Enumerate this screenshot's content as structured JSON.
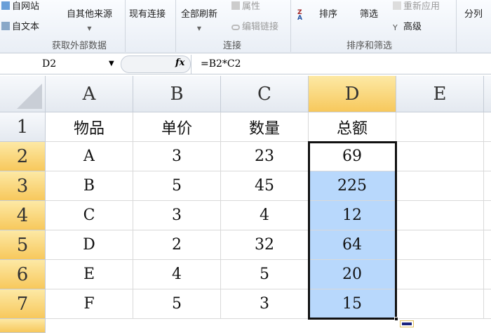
{
  "ribbon": {
    "from_web": "自网站",
    "from_text": "自文本",
    "from_other": "自其他来源",
    "existing": "现有连接",
    "refresh_all": "全部刷新",
    "properties": "属性",
    "edit_links": "编辑链接",
    "sort": "排序",
    "filter": "筛选",
    "reapply": "重新应用",
    "advanced": "高级",
    "split": "分列",
    "groups": [
      "获取外部数据",
      "连接",
      "排序和筛选"
    ]
  },
  "formula_bar": {
    "name_box": "D2",
    "fx": "fx",
    "formula": "=B2*C2"
  },
  "columns": [
    "A",
    "B",
    "C",
    "D",
    "E"
  ],
  "rows": [
    "1",
    "2",
    "3",
    "4",
    "5",
    "6",
    "7"
  ],
  "table": [
    [
      "物品",
      "单价",
      "数量",
      "总额"
    ],
    [
      "A",
      "3",
      "23",
      "69"
    ],
    [
      "B",
      "5",
      "45",
      "225"
    ],
    [
      "C",
      "3",
      "4",
      "12"
    ],
    [
      "D",
      "2",
      "32",
      "64"
    ],
    [
      "E",
      "4",
      "5",
      "20"
    ],
    [
      "F",
      "5",
      "3",
      "15"
    ]
  ]
}
